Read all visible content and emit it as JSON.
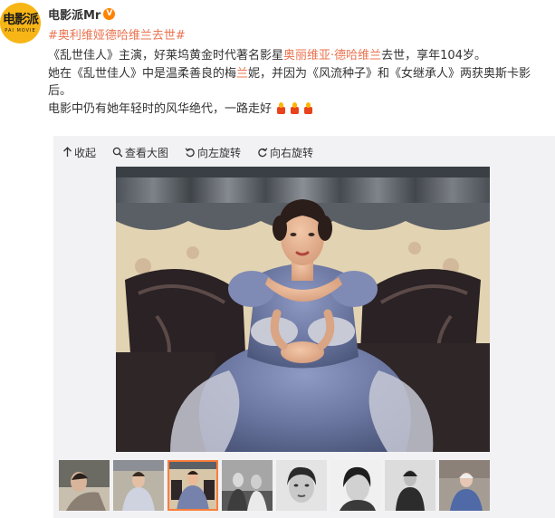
{
  "post": {
    "avatar_text": "电影派",
    "avatar_sub": "PAI MOVIE",
    "username": "电影派Mr",
    "hashtag": "#奥利维娅德哈维兰去世#",
    "line1_pre": "《乱世佳人》主演，好莱坞黄金时代著名影星",
    "line1_hl": "奥丽维亚·德哈维兰",
    "line1_post": "去世，享年104岁。",
    "line2_pre": "她在《乱世佳人》中是温柔善良的梅",
    "line2_hl": "兰",
    "line2_post": "妮，并因为《风流种子》和《女继承人》两获奥斯卡影后。",
    "line3": "电影中仍有她年轻时的风华绝代，一路走好"
  },
  "toolbar": {
    "collapse": "收起",
    "view_large": "查看大图",
    "rotate_left": "向左旋转",
    "rotate_right": "向右旋转"
  },
  "colors": {
    "link": "#eb7350",
    "verified": "#ff8200",
    "avatar_bg": "#f7b516",
    "active_thumb": "#fa7d3c"
  }
}
